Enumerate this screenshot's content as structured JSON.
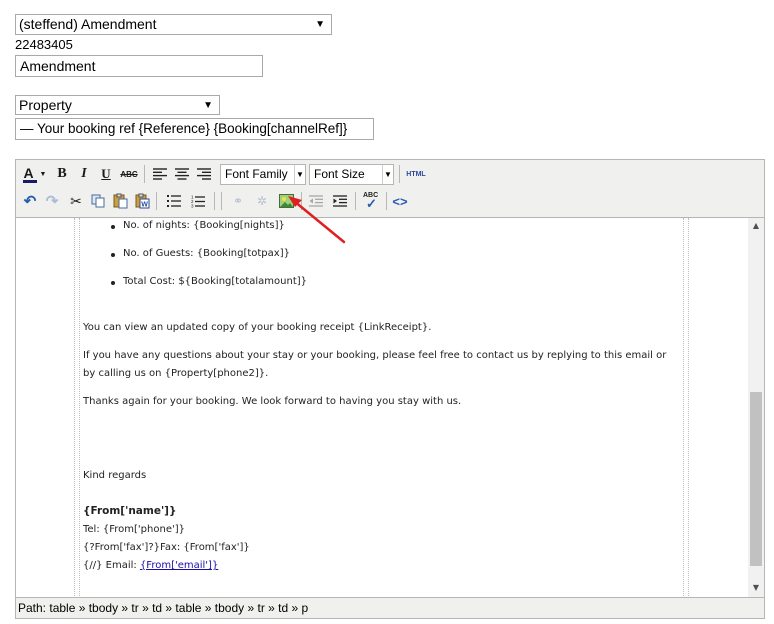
{
  "form": {
    "sender_select": "(steffend) Amendment",
    "template_id": "22483405",
    "name_value": "Amendment",
    "type_select": "Property",
    "subject_value": "— Your booking ref {Reference} {Booking[channelRef]}"
  },
  "toolbar": {
    "font_family": "Font Family",
    "font_size": "Font Size",
    "html_label": "HTML",
    "strike_label": "ABC",
    "spell_label": "ABC"
  },
  "content": {
    "bullets": [
      "No. of nights: {Booking[nights]}",
      "No. of Guests: {Booking[totpax]}",
      "Total Cost: ${Booking[totalamount]}"
    ],
    "para_receipt": "You can view an updated copy of your booking receipt {LinkReceipt}.",
    "para_questions_1": "If you have any questions about your stay or your booking, please feel free to contact us by replying to this email or",
    "para_questions_2": "by calling us on {Property[phone2]}.",
    "para_thanks": "Thanks again for your booking. We look forward to having you stay with us.",
    "kind_regards": "Kind regards",
    "from_name": "{From['name']}",
    "tel_line": "Tel: {From['phone']}",
    "fax_line": "{?From['fax']?}Fax: {From['fax']}",
    "email_prefix": "{//} Email: ",
    "email_link": "{From['email']}"
  },
  "status": {
    "path": "Path: table » tbody » tr » td » table » tbody » tr » td » p"
  },
  "colors": {
    "annotation_arrow": "#e02020",
    "link": "#1a0dab"
  },
  "icons": [
    "font-color-icon",
    "bold-icon",
    "italic-icon",
    "underline-icon",
    "strikethrough-icon",
    "align-left-icon",
    "align-center-icon",
    "align-right-icon",
    "undo-icon",
    "redo-icon",
    "cut-icon",
    "copy-icon",
    "paste-icon",
    "paste-word-icon",
    "bullet-list-icon",
    "numbered-list-icon",
    "link-icon",
    "unlink-icon",
    "image-icon",
    "outdent-icon",
    "indent-icon",
    "spellcheck-icon",
    "code-icon"
  ]
}
